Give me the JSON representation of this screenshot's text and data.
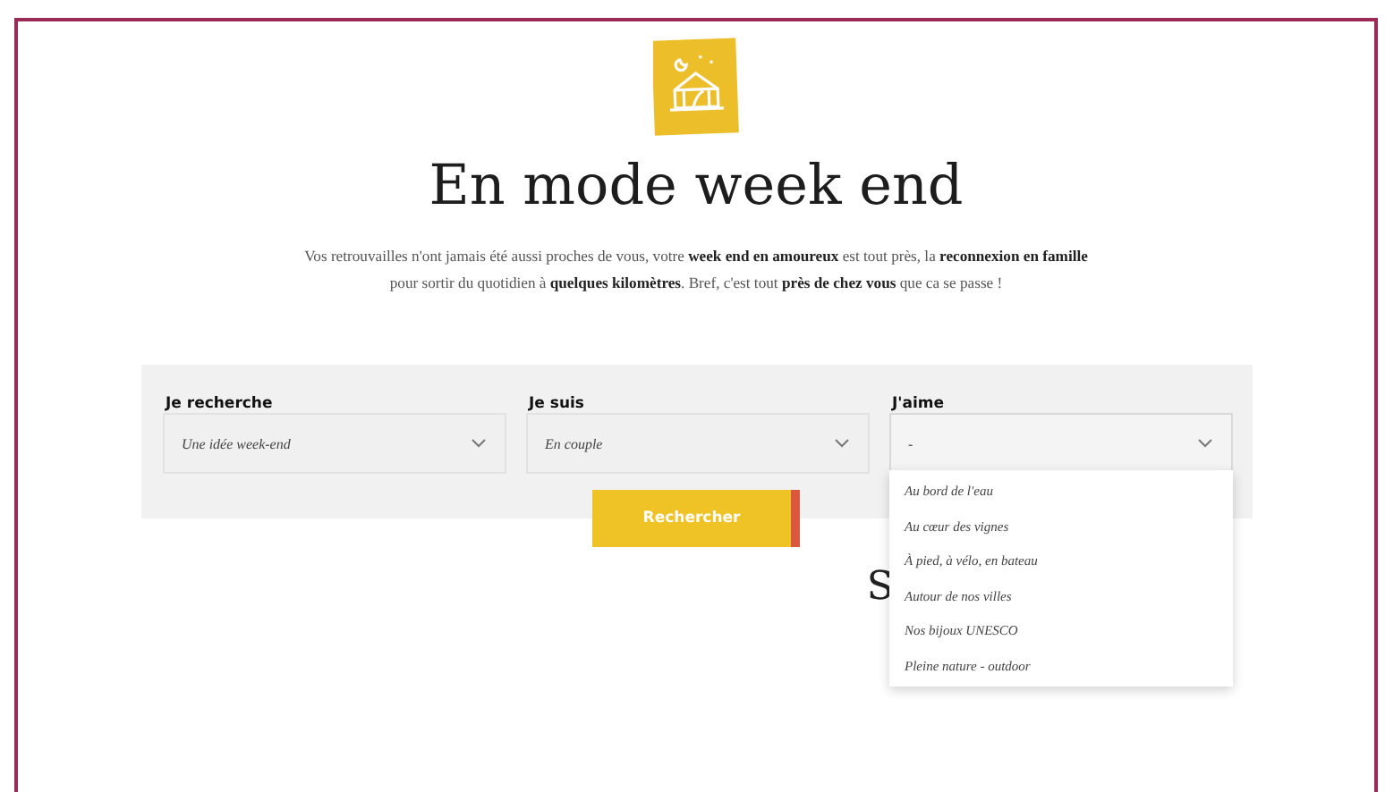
{
  "title": "En mode week end",
  "intro": "Vos retrouvailles n'ont jamais été aussi proches de vous, votre **week end en amoureux** est tout près, la **reconnexion en famille** pour sortir du quotidien à **quelques kilomètres**. Bref, c'est tout **près de chez vous** que ca se passe !",
  "filters": [
    {
      "label": "Je recherche",
      "value": "Une idée week-end",
      "expanded": false
    },
    {
      "label": "Je suis",
      "value": "En couple",
      "expanded": false
    },
    {
      "label": "J'aime",
      "value": "-",
      "expanded": true
    }
  ],
  "dropdown_options": [
    "Au bord de l'eau",
    "Au cœur des vignes",
    "À pied, à vélo, en bateau",
    "Autour de nos villes",
    "Nos bijoux UNESCO",
    "Pleine nature - outdoor"
  ],
  "search_button": "Rechercher",
  "next_heading": "S"
}
